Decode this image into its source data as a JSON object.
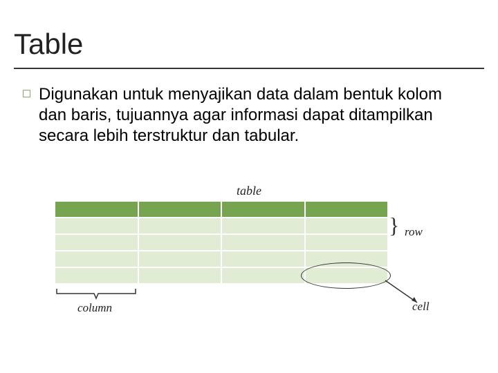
{
  "title": "Table",
  "body_text": "Digunakan untuk menyajikan data dalam bentuk kolom dan baris, tujuannya agar informasi dapat ditampilkan secara lebih terstruktur dan tabular.",
  "diagram": {
    "table_label": "table",
    "row_label": "row",
    "column_label": "column",
    "cell_label": "cell",
    "columns": 4,
    "header_rows": 1,
    "data_rows": 4,
    "colors": {
      "header": "#77a450",
      "data": "#e1ecd4",
      "bullet_border": "#8fa760"
    }
  }
}
